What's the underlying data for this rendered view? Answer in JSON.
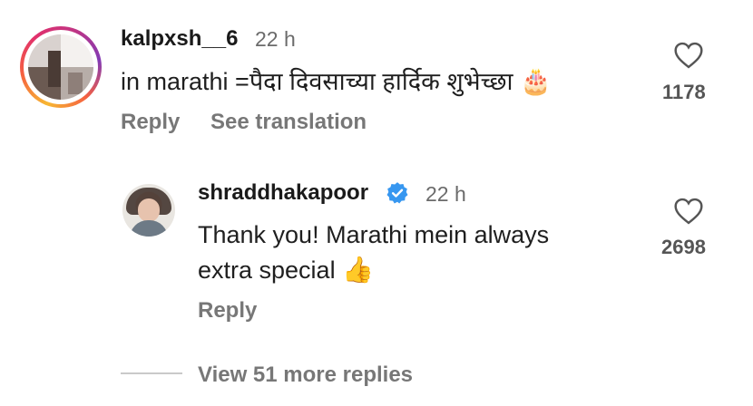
{
  "comment": {
    "username": "kalpxsh__6",
    "time": "22 h",
    "text": "in marathi =पैदा दिवसाच्या हार्दिक शुभेच्छा",
    "emoji": "🎂",
    "reply_label": "Reply",
    "translate_label": "See translation",
    "like_count": "1178",
    "like_icon": "heart-outline-icon"
  },
  "reply": {
    "username": "shraddhakapoor",
    "verified_icon": "verified-badge-icon",
    "time": "22 h",
    "text_line1": "Thank you! Marathi mein always",
    "text_line2": "extra special",
    "emoji": "👍",
    "reply_label": "Reply",
    "like_count": "2698",
    "like_icon": "heart-outline-icon"
  },
  "thread": {
    "view_more_label": "View 51 more replies"
  },
  "colors": {
    "verified_blue": "#3797f0",
    "secondary_text": "#777777",
    "count_text": "#555555"
  }
}
